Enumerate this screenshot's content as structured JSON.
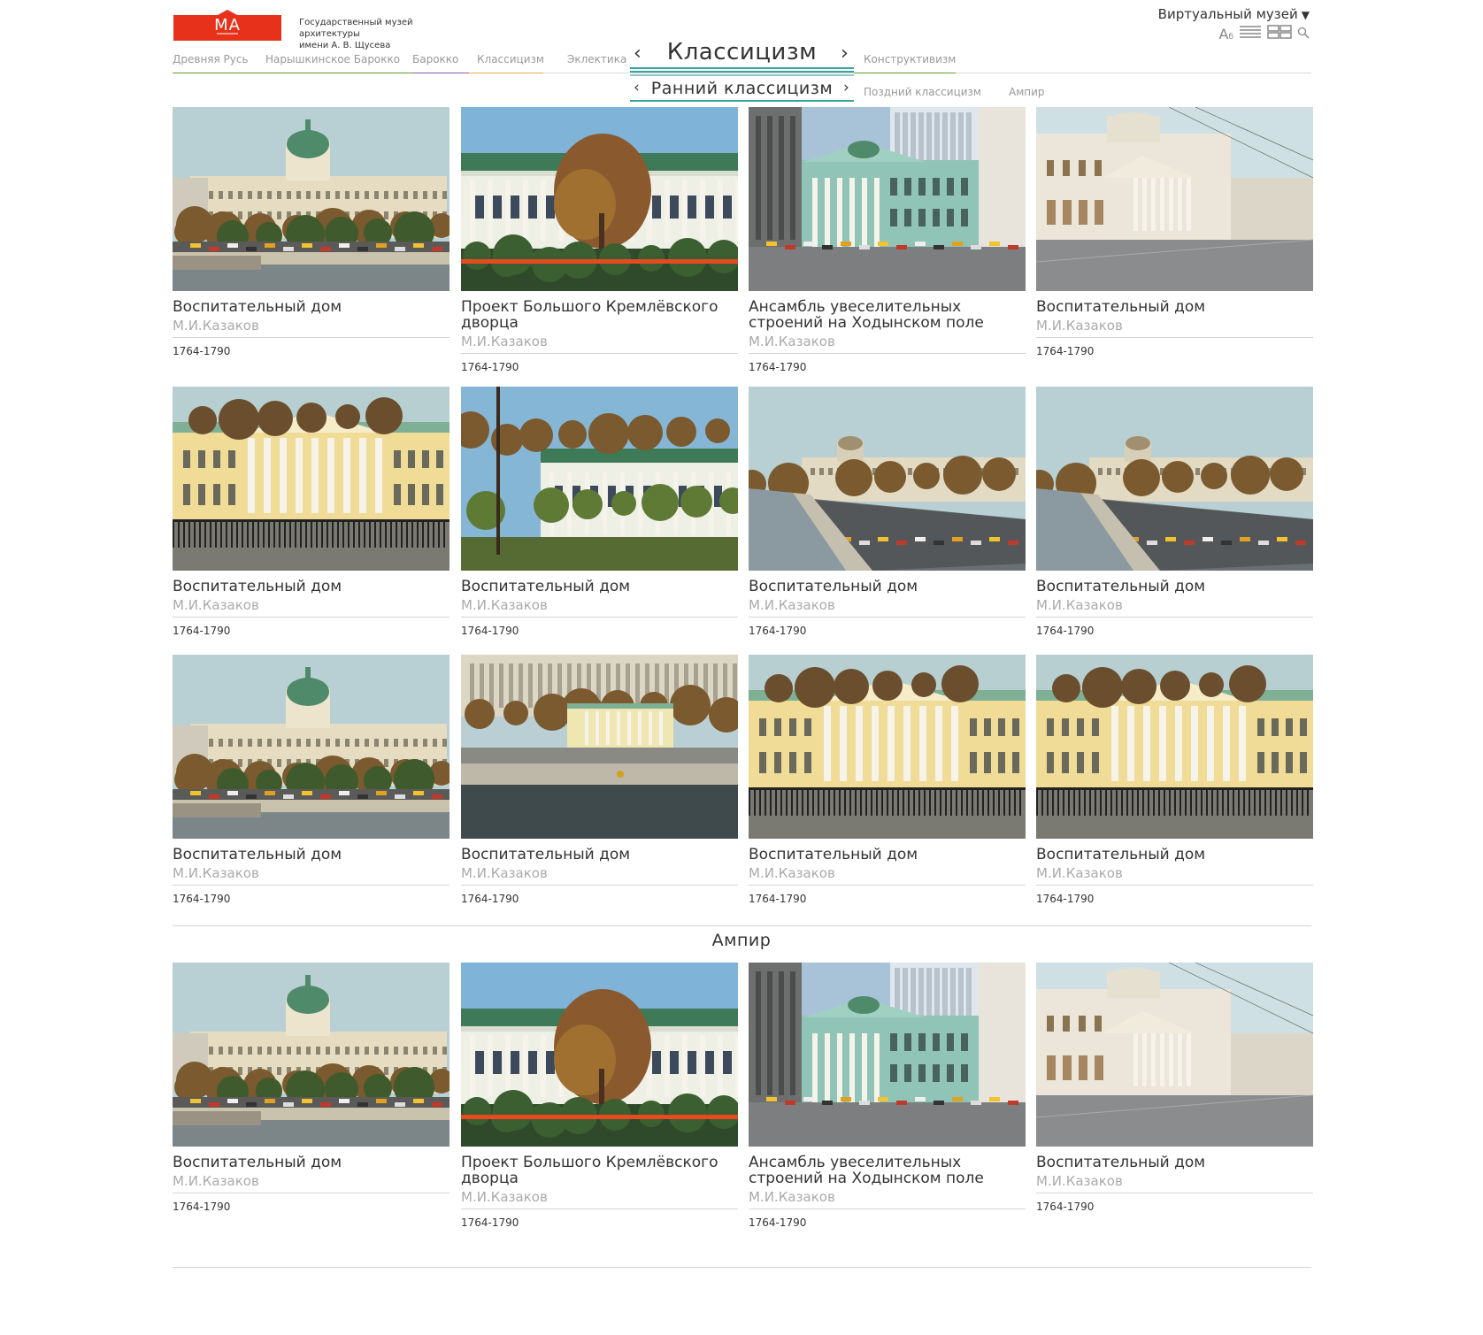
{
  "header": {
    "logo_text": "MA",
    "museum_name_line1": "Государственный музей архитектуры",
    "museum_name_line2": "имени А. В. Щусева",
    "virtual_museum": "Виртуальный музей",
    "dropdown_arrow": "▼",
    "font_tool": "А",
    "font_tool_small": "б",
    "brand_color": "#e8311a"
  },
  "nav": {
    "items": [
      {
        "label": "Древняя Русь",
        "color": "#5aa02c"
      },
      {
        "label": "Нарышкинское Барокко",
        "color": "#5aa02c"
      },
      {
        "label": "Барокко",
        "color": "#8a5aa8"
      },
      {
        "label": "Классицизм",
        "color": "#e8b04a"
      },
      {
        "label": "Эклектика",
        "color": "#cccccc"
      },
      {
        "label": "Конструктивизм",
        "color": "#5aa02c"
      }
    ],
    "current": "Классицизм",
    "prev": "‹",
    "next": "›"
  },
  "subnav": {
    "current": "Ранний классицизм",
    "prev": "‹",
    "next": "›",
    "items": [
      "Поздний классицизм",
      "Ампир"
    ]
  },
  "cards": [
    {
      "title": "Воспитательный дом",
      "author": "М.И.Казаков",
      "date": "1764-1790",
      "scene": "river-dome"
    },
    {
      "title": "Проект Большого Кремлёвского дворца",
      "author": "М.И.Казаков",
      "date": "1764-1790",
      "scene": "palace-tree"
    },
    {
      "title": "Ансамбль увеселительных строений на Ходынском поле",
      "author": "М.И.Казаков",
      "date": "1764-1790",
      "scene": "green-building"
    },
    {
      "title": "Воспитательный дом",
      "author": "М.И.Казаков",
      "date": "1764-1790",
      "scene": "street-rotunda"
    },
    {
      "title": "Воспитательный дом",
      "author": "М.И.Казаков",
      "date": "1764-1790",
      "scene": "yellow-columns"
    },
    {
      "title": "Воспитательный дом",
      "author": "М.И.Казаков",
      "date": "1764-1790",
      "scene": "palace-trees"
    },
    {
      "title": "Воспитательный дом",
      "author": "М.И.Казаков",
      "date": "1764-1790",
      "scene": "embankment"
    },
    {
      "title": "Воспитательный дом",
      "author": "М.И.Казаков",
      "date": "1764-1790",
      "scene": "embankment"
    },
    {
      "title": "Воспитательный дом",
      "author": "М.И.Казаков",
      "date": "1764-1790",
      "scene": "river-dome"
    },
    {
      "title": "Воспитательный дом",
      "author": "М.И.Казаков",
      "date": "1764-1790",
      "scene": "river-yellow"
    },
    {
      "title": "Воспитательный дом",
      "author": "М.И.Казаков",
      "date": "1764-1790",
      "scene": "yellow-columns"
    },
    {
      "title": "Воспитательный дом",
      "author": "М.И.Казаков",
      "date": "1764-1790",
      "scene": "yellow-columns"
    }
  ],
  "section2": {
    "title": "Ампир",
    "cards": [
      {
        "title": "Воспитательный дом",
        "author": "М.И.Казаков",
        "date": "1764-1790",
        "scene": "river-dome"
      },
      {
        "title": "Проект Большого Кремлёвского дворца",
        "author": "М.И.Казаков",
        "date": "1764-1790",
        "scene": "palace-tree"
      },
      {
        "title": "Ансамбль увеселительных строений на Ходынском поле",
        "author": "М.И.Казаков",
        "date": "1764-1790",
        "scene": "green-building"
      },
      {
        "title": "Воспитательный дом",
        "author": "М.И.Казаков",
        "date": "1764-1790",
        "scene": "street-rotunda"
      }
    ]
  }
}
